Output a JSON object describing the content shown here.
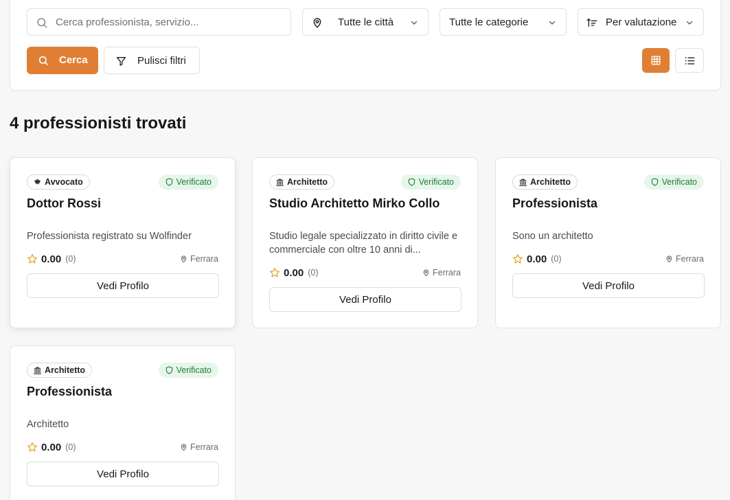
{
  "filters": {
    "search_placeholder": "Cerca professionista, servizio...",
    "city": "Tutte le città",
    "category": "Tutte le categorie",
    "sort": "Per valutazione",
    "search_button": "Cerca",
    "clear_button": "Pulisci filtri"
  },
  "colors": {
    "accent": "#e07f33",
    "verified_bg": "#e6f6ea",
    "verified_text": "#1e7a3a",
    "star": "#e0a82e"
  },
  "results": {
    "heading": "4 professionisti trovati"
  },
  "cards": [
    {
      "category": "Avvocato",
      "category_icon": "eagle-icon",
      "verified": "Verificato",
      "title": "Dottor Rossi",
      "description": "Professionista registrato su Wolfinder",
      "rating": "0.00",
      "reviews": "(0)",
      "city": "Ferrara",
      "button": "Vedi Profilo"
    },
    {
      "category": "Architetto",
      "category_icon": "classical-building-icon",
      "verified": "Verificato",
      "title": "Studio Architetto Mirko Collo",
      "description": "Studio legale specializzato in diritto civile e commerciale con oltre 10 anni di...",
      "rating": "0.00",
      "reviews": "(0)",
      "city": "Ferrara",
      "button": "Vedi Profilo"
    },
    {
      "category": "Architetto",
      "category_icon": "classical-building-icon",
      "verified": "Verificato",
      "title": "Professionista",
      "description": "Sono un architetto",
      "rating": "0.00",
      "reviews": "(0)",
      "city": "Ferrara",
      "button": "Vedi Profilo"
    },
    {
      "category": "Architetto",
      "category_icon": "classical-building-icon",
      "verified": "Verificato",
      "title": "Professionista",
      "description": "Architetto",
      "rating": "0.00",
      "reviews": "(0)",
      "city": "Ferrara",
      "button": "Vedi Profilo"
    }
  ]
}
